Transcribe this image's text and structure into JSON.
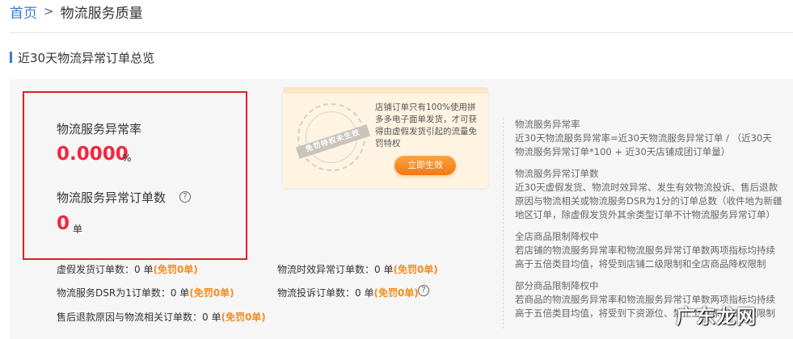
{
  "breadcrumb": {
    "home": "首页",
    "separator": ">",
    "current": "物流服务质量"
  },
  "section": {
    "title": "近30天物流异常订单总览"
  },
  "metrics": {
    "rate_label": "物流服务异常率",
    "rate_value": "0.0000",
    "rate_unit": "%",
    "count_label": "物流服务异常订单数",
    "count_value": "0",
    "count_unit": "单",
    "help_icon": "?"
  },
  "stats": [
    {
      "label": "虚假发货订单数：0 单",
      "tag": "(免罚0单)"
    },
    {
      "label": "物流时效异常订单数：0 单",
      "tag": "(免罚0单)"
    },
    {
      "label": "物流服务DSR为1订单数：0 单",
      "tag": "(免罚0单)"
    },
    {
      "label": "物流投诉订单数：0 单",
      "tag": "(免罚0单)"
    },
    {
      "label": "售后退款原因与物流相关订单数：0 单",
      "tag": "(免罚0单)"
    }
  ],
  "promo": {
    "seal_text": "免罚特权未生效",
    "text": "店铺订单只有100%使用拼多多电子面单发货，才可获得由虚假发货引起的流量免罚特权",
    "button": "立即生效"
  },
  "descriptions": [
    {
      "title": "物流服务异常率",
      "lines": [
        "近30天物流服务异常率=近30天物流服务异常订单 / （近30天",
        "物流服务异常订单*100 + 近30天店铺成团订单量）"
      ]
    },
    {
      "title": "物流服务异常订单数",
      "lines": [
        "近30天虚假发货、物流时效异常、发生有效物流投诉、售后退款",
        "原因与物流相关或物流服务DSR为1分的订单总数（收件地为新疆",
        "地区订单，除虚假发货外其余类型订单不计物流服务异常订单）"
      ]
    },
    {
      "title": "全店商品限制降权中",
      "lines": [
        "若店铺的物流服务异常率和物流服务异常订单数两项指标均持续",
        "高于五倍类目均值，将受到店铺二级限制和全店商品降权限制"
      ]
    },
    {
      "title": "部分商品限制降权中",
      "lines": [
        "若商品的物流服务异常率和物流服务异常订单数两项指标均持续",
        "高于五倍类目均值，将受到下资源位、禁止上资源位和降权限制"
      ]
    }
  ],
  "watermark": "广东龙网",
  "colors": {
    "accent": "#3a7bd5",
    "value_red": "#f0283c",
    "free_orange": "#f58c1e",
    "highlight_border": "#e02020"
  }
}
